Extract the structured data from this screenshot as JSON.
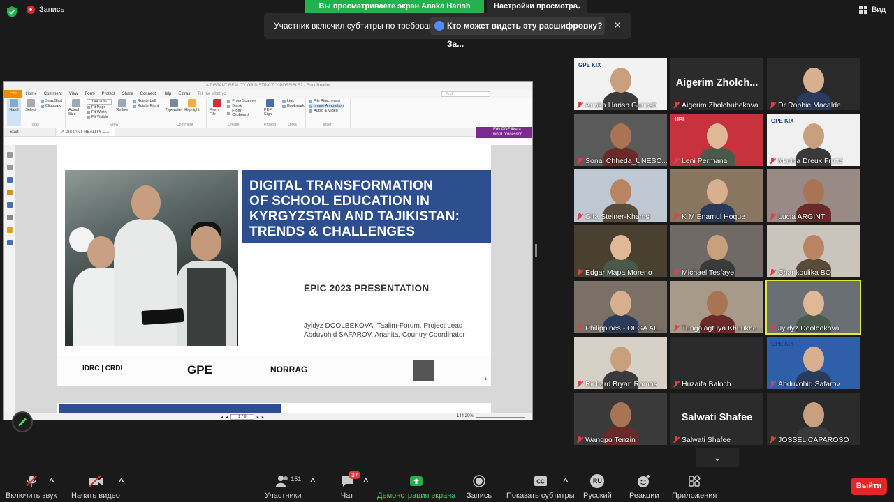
{
  "top": {
    "record_label": "Запись",
    "share_banner": "Вы просматриваете экран Anaka Harish Ganesh",
    "view_settings": "Настройки просмотра",
    "view_label": "Вид"
  },
  "caption_notice": {
    "text": "Участник включил субтитры по требованию",
    "button": "Кто может видеть эту расшифровку? За..."
  },
  "shared_app": {
    "window_title": "A DISTANT REALITY OR DISTINCTLY POSSIBLE? - Foxit Reader",
    "tabs": [
      "File",
      "Home",
      "Comment",
      "View",
      "Form",
      "Protect",
      "Share",
      "Connect",
      "Help",
      "Extras"
    ],
    "tell_me": "Tell me what yo",
    "find": "Find",
    "ribbon": {
      "hand": "Hand",
      "select": "Select",
      "snapshot": "SnapShot",
      "clipboard": "Clipboard",
      "tools_group": "Tools",
      "actual_size": "Actual Size",
      "zoom": "144.20%",
      "fit_page": "Fit Page",
      "fit_width": "Fit Width",
      "fit_visible": "Fit Visible",
      "reflow": "Reflow",
      "rotate_left": "Rotate Left",
      "rotate_right": "Rotate Right",
      "view_group": "View",
      "typewriter": "Typewriter",
      "highlight": "Highlight",
      "comment_group": "Comment",
      "from_file": "From File",
      "from_scanner": "From Scanner",
      "blank": "Blank",
      "from_clipboard": "From Clipboard",
      "create_group": "Create",
      "pdf_sign": "PDF Sign",
      "protect_group": "Protect",
      "link": "Link",
      "bookmark": "Bookmark",
      "links_group": "Links",
      "file_attachment": "File Attachment",
      "image_annotation": "Image Annotation",
      "audio_video": "Audio & Video",
      "insert_group": "Insert"
    },
    "doc_tabs": [
      "Start",
      "A DISTANT REALITY O..."
    ],
    "edit_pdf": "Edit PDF like a word processor",
    "slide": {
      "title_lines": [
        "DIGITAL TRANSFORMATION",
        "OF SCHOOL EDUCATION IN",
        "KYRGYZSTAN AND TAJIKISTAN:",
        "TRENDS & CHALLENGES"
      ],
      "subtitle": "EPIC 2023 PRESENTATION",
      "author1": "Jyldyz DOOLBEKOVA, Taalim-Forum, Project Lead",
      "author2": "Abduvohid SAFAROV, Anahita, Country Coordinator",
      "logos": [
        "IDRC | CRDI",
        "GPE",
        "NORRAG"
      ],
      "page_number": "1"
    },
    "status": {
      "page": "1 / 9",
      "zoom": "144.20%"
    }
  },
  "participants": [
    {
      "name": "Anaka Harish Ganesh",
      "type": "video",
      "color": "#f2f2f2"
    },
    {
      "name": "Aigerim Zholchubekova",
      "type": "text",
      "big": "Aigerim  Zholch..."
    },
    {
      "name": "Dr Robbie Macalde",
      "type": "video",
      "color": "#2a2a2a"
    },
    {
      "name": "Sonal Chheda_UNESC...",
      "type": "video",
      "color": "#5a5a5a"
    },
    {
      "name": "Leni Permana",
      "type": "video",
      "color": "#c8323c"
    },
    {
      "name": "Marina Dreux Frotté",
      "type": "video",
      "color": "#f0f0f0"
    },
    {
      "name": "Gita Steiner-Khamsi",
      "type": "video",
      "color": "#bfc8d2"
    },
    {
      "name": "K M Enamul Hoque",
      "type": "video",
      "color": "#8a7560"
    },
    {
      "name": "Lucia ARGINT",
      "type": "video",
      "color": "#9a8a86"
    },
    {
      "name": "Edgar Mapa Moreno",
      "type": "video",
      "color": "#4a4030"
    },
    {
      "name": "Michael Tesfaye",
      "type": "video",
      "color": "#6f6a66"
    },
    {
      "name": "Chankoulika BO",
      "type": "video",
      "color": "#c9c4bc"
    },
    {
      "name": "Philippines - OLGA AL...",
      "type": "video",
      "color": "#7a7066"
    },
    {
      "name": "Tungalagtuya Khuukhe...",
      "type": "video",
      "color": "#a89a88"
    },
    {
      "name": "Jyldyz Doolbekova",
      "type": "video",
      "color": "#6a6f76",
      "active": true
    },
    {
      "name": "Richard Bryan Ramos",
      "type": "video",
      "color": "#d6d0c6"
    },
    {
      "name": "Huzaifa Baloch",
      "type": "text",
      "big": ""
    },
    {
      "name": "Abduvohid Safarov",
      "type": "video",
      "color": "#2f5fa8"
    },
    {
      "name": "Wangpo Tenzin",
      "type": "video",
      "color": "#3a3a3a"
    },
    {
      "name": "Salwati Shafee",
      "type": "text",
      "big": "Salwati Shafee"
    },
    {
      "name": "JOSSEL CAPAROSO",
      "type": "video",
      "color": "#2b2b2b"
    }
  ],
  "tile_logos": {
    "gpe_kix": "GPE KIX",
    "upi": "UPI"
  },
  "toolbar": {
    "mute": "Включить звук",
    "video": "Начать видео",
    "participants": "Участники",
    "participants_count": "151",
    "chat": "Чат",
    "chat_badge": "37",
    "share": "Демонстрация экрана",
    "record": "Запись",
    "captions": "Показать субтитры",
    "language": "Русский",
    "language_code": "RU",
    "reactions": "Реакции",
    "apps": "Приложения",
    "leave": "Выйти"
  },
  "colors": {
    "green": "#22b14c",
    "slide_blue": "#2d4f8f",
    "leave_red": "#e02828",
    "active_outline": "#e4e83c"
  }
}
